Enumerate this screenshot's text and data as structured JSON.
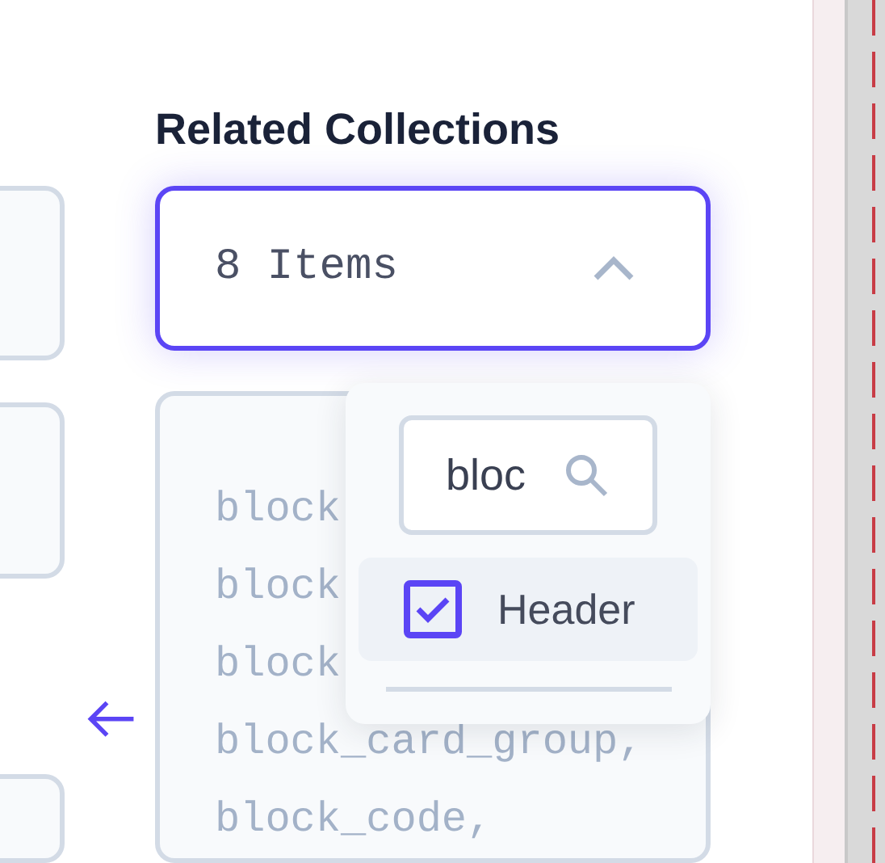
{
  "heading": "Related Collections",
  "select": {
    "value": "8 Items",
    "expanded": true
  },
  "code_lines": [
    "block",
    "block",
    "block",
    "block_card_group,",
    "block_code,"
  ],
  "dropdown": {
    "search": {
      "value": "bloc"
    },
    "options": [
      {
        "label": "Header",
        "checked": true
      }
    ]
  }
}
